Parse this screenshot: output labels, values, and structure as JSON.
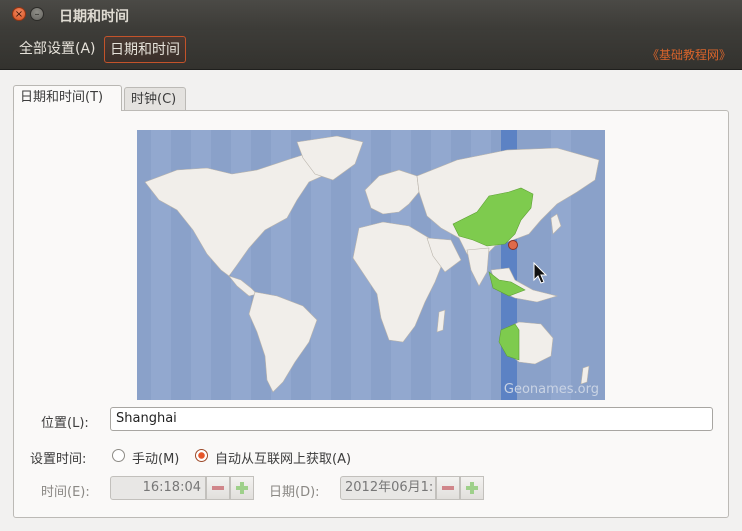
{
  "window": {
    "title": "日期和时间",
    "close_icon": "×",
    "min_icon": "–"
  },
  "toolbar": {
    "all_settings": "全部设置(A)",
    "current": "日期和时间",
    "watermark": "《基础教程网》"
  },
  "tabs": [
    {
      "label": "日期和时间(T)",
      "active": true
    },
    {
      "label": "时钟(C)",
      "active": false
    }
  ],
  "map": {
    "credit": "Geonames.org",
    "highlight_color": "#7ecb4e",
    "ocean_color": "#8aa1c9"
  },
  "location": {
    "label": "位置(L):",
    "value": "Shanghai"
  },
  "set_time": {
    "label": "设置时间:",
    "manual": "手动(M)",
    "auto": "自动从互联网上获取(A)",
    "selected": "auto"
  },
  "time": {
    "label": "时间(E):",
    "value": "16:18:04"
  },
  "date": {
    "label": "日期(D):",
    "value": "2012年06月1:"
  }
}
